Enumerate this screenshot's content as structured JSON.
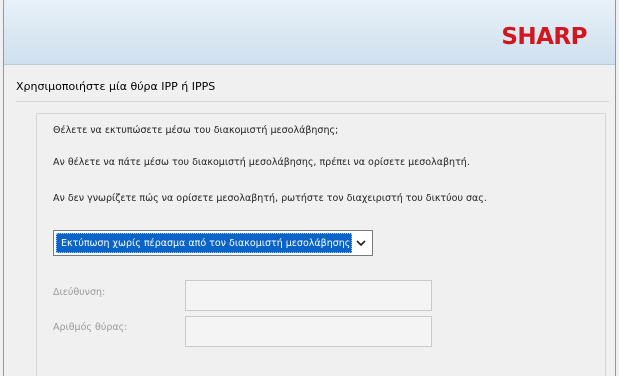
{
  "header": {
    "brand": "SHARP"
  },
  "title": "Χρησιμοποιήστε μία θύρα IPP ή IPPS",
  "panel": {
    "question": "Θέλετε να εκτυπώσετε μέσω του διακομιστή μεσολάβησης;",
    "info_1": "Αν θέλετε να πάτε μέσω του διακομιστή μεσολάβησης, πρέπει να ορίσετε μεσολαβητή.",
    "info_2": "Αν δεν γνωρίζετε πώς να ορίσετε μεσολαβητή, ρωτήστε τον διαχειριστή του δικτύου σας.",
    "proxy_select": {
      "selected": "Εκτύπωση χωρίς πέρασμα από τον διακομιστή μεσολάβησης"
    },
    "address": {
      "label": "Διεύθυνση:",
      "value": ""
    },
    "port": {
      "label": "Αριθμός θύρας:",
      "value": ""
    }
  },
  "colors": {
    "brand_red": "#d2161e",
    "selection_blue": "#0a64c8"
  }
}
